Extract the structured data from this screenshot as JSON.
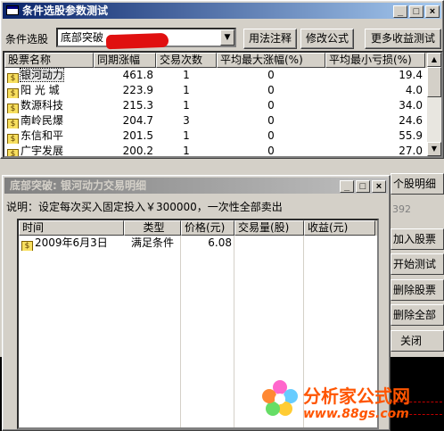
{
  "main_window": {
    "title": "条件选股参数测试",
    "condition_label": "条件选股",
    "condition_value": "底部突破",
    "buttons": {
      "usage": "用法注释",
      "modify": "修改公式",
      "more_profit": "更多收益测试"
    },
    "columns": [
      "股票名称",
      "同期涨幅",
      "交易次数",
      "平均最大涨幅(%)",
      "平均最小亏损(%)"
    ],
    "rows": [
      {
        "name": "银河动力",
        "gain": "461.8",
        "trades": "1",
        "max_rise": "0",
        "min_loss": "19.4"
      },
      {
        "name": "阳 光 城",
        "gain": "223.9",
        "trades": "1",
        "max_rise": "0",
        "min_loss": "4.0"
      },
      {
        "name": "数源科技",
        "gain": "215.3",
        "trades": "1",
        "max_rise": "0",
        "min_loss": "34.0"
      },
      {
        "name": "南岭民爆",
        "gain": "204.7",
        "trades": "3",
        "max_rise": "0",
        "min_loss": "24.6"
      },
      {
        "name": "东信和平",
        "gain": "201.5",
        "trades": "1",
        "max_rise": "0",
        "min_loss": "55.9"
      },
      {
        "name": "广宇发展",
        "gain": "200.2",
        "trades": "1",
        "max_rise": "0",
        "min_loss": "27.0"
      }
    ]
  },
  "right_buttons": {
    "detail": "个股明细",
    "code_partial": "392",
    "add_stock": "加入股票",
    "start_test": "开始测试",
    "delete_stock": "删除股票",
    "delete_all": "删除全部",
    "close": "关闭"
  },
  "detail_window": {
    "title": "底部突破: 银河动力交易明细",
    "description": "说明：设定每次买入固定投入￥300000，一次性全部卖出",
    "columns": [
      "时间",
      "类型",
      "价格(元)",
      "交易量(股)",
      "收益(元)"
    ],
    "rows": [
      {
        "time": "2009年6月3日",
        "type": "满足条件",
        "price": "6.08",
        "volume": "",
        "profit": ""
      }
    ]
  },
  "watermark": {
    "text": "分析家公式网",
    "url": "www.88gs.com"
  },
  "colors": {
    "titlebar_active": "#0a246a",
    "titlebar_inactive": "#808080",
    "face": "#d4d0c8",
    "watermark": "#ff5500"
  }
}
